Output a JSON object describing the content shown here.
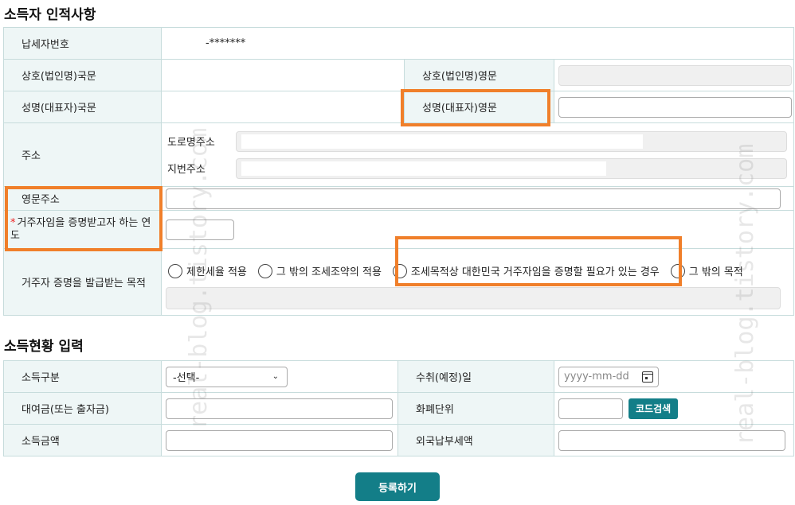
{
  "section1": {
    "title": "소득자 인적사항"
  },
  "person": {
    "tin_label": "납세자번호",
    "tin_value": "-*******",
    "name_kr_label": "상호(법인명)국문",
    "name_en_label": "상호(법인명)영문",
    "rep_kr_label": "성명(대표자)국문",
    "rep_en_label": "성명(대표자)영문",
    "address_label": "주소",
    "road_label": "도로명주소",
    "lot_label": "지번주소",
    "en_address_label": "영문주소",
    "year_label": "거주자임을 증명받고자 하는 연도",
    "year_required_mark": "*",
    "purpose_label": "거주자 증명을 발급받는 목적",
    "purpose_options": [
      "제한세율 적용",
      "그 밖의 조세조약의 적용",
      "조세목적상 대한민국 거주자임을 증명할 필요가 있는 경우",
      "그 밖의 목적"
    ]
  },
  "section2": {
    "title": "소득현황 입력"
  },
  "income": {
    "type_label": "소득구분",
    "type_selected": "-선택-",
    "pay_date_label": "수취(예정)일",
    "pay_date_placeholder": "yyyy-mm-dd",
    "loan_label": "대여금(또는 출자금)",
    "currency_label": "화폐단위",
    "code_search_button": "코드검색",
    "amount_label": "소득금액",
    "foreign_tax_label": "외국납부세액"
  },
  "submit_button": "등록하기",
  "watermark": "real-blog.tistory.com",
  "colors": {
    "accent": "#137e88",
    "highlight": "#f07f2a",
    "label_bg": "#eef6f6"
  }
}
